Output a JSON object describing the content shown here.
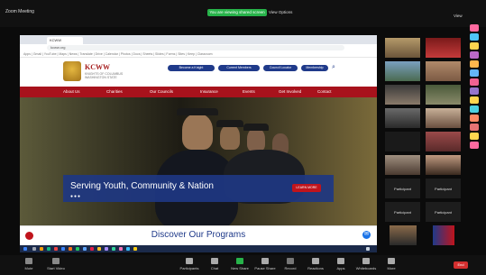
{
  "zoom": {
    "window_title": "Zoom Meeting",
    "share_status": "You are viewing shared screen",
    "view_options": "View Options",
    "view_button": "View",
    "controls": [
      {
        "label": "Mute",
        "icon": "microphone-muted-icon"
      },
      {
        "label": "Start Video",
        "icon": "video-off-icon"
      },
      {
        "label": "Participants",
        "icon": "participants-icon"
      },
      {
        "label": "Chat",
        "icon": "chat-icon"
      },
      {
        "label": "New Share",
        "icon": "share-screen-icon"
      },
      {
        "label": "Pause Share",
        "icon": "pause-icon"
      },
      {
        "label": "Record",
        "icon": "record-icon"
      },
      {
        "label": "Reactions",
        "icon": "reactions-icon"
      },
      {
        "label": "Apps",
        "icon": "apps-icon"
      },
      {
        "label": "Whiteboards",
        "icon": "whiteboard-icon"
      },
      {
        "label": "More",
        "icon": "more-icon"
      }
    ],
    "end_button": "End"
  },
  "browser": {
    "active_tab": "KCWW",
    "address": "kcww.org",
    "bookmarks": "Apps  |  Gmail  |  YouTube  |  Maps  |  News  |  Translate  |  Drive  |  Calendar  |  Photos  |  Docs  |  Sheets  |  Slides  |  Forms  |  Sites  |  Keep  |  Classroom"
  },
  "site": {
    "logo_text": "KCWW",
    "logo_subtitle": "KNIGHTS OF COLUMBUS WASHINGTON STATE",
    "header_buttons": [
      "Become a Knight",
      "Current Members",
      "Council Locator",
      "Membership"
    ],
    "nav": [
      "About Us",
      "Charities",
      "Our Councils",
      "Insurance",
      "Events",
      "Get Involved",
      "Contact"
    ],
    "hero_title": "Serving Youth, Community & Nation",
    "hero_button": "LEARN MORE",
    "discover_title": "Discover Our Programs"
  },
  "gallery": {
    "name_tiles": [
      "Participant",
      "Participant",
      "Participant",
      "Participant"
    ]
  },
  "colors": {
    "zoom_green": "#27b34a",
    "site_red": "#a8121c",
    "site_blue": "#1f3a8a",
    "end_red": "#d32f2f"
  }
}
